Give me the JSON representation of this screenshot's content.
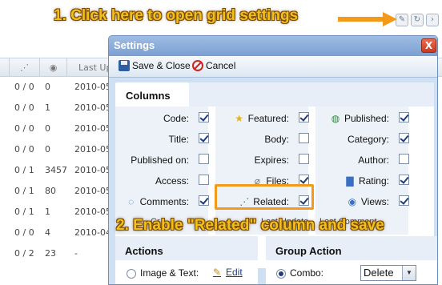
{
  "annotations": {
    "step1": "1. Click here to open grid settings",
    "step2": "2. Enable \"Related\" column and save"
  },
  "grid": {
    "header": {
      "col1_icon": "sort-icon",
      "col2_icon": "related-icon",
      "col3_icon": "views-icon",
      "col4": "Last Up"
    },
    "rows": [
      {
        "related": "0 / 0",
        "views": "0",
        "updated": "2010-05"
      },
      {
        "related": "0 / 0",
        "views": "1",
        "updated": "2010-05"
      },
      {
        "related": "0 / 0",
        "views": "0",
        "updated": "2010-05"
      },
      {
        "related": "0 / 0",
        "views": "0",
        "updated": "2010-05"
      },
      {
        "related": "0 / 1",
        "views": "3457",
        "updated": "2010-05"
      },
      {
        "related": "0 / 1",
        "views": "80",
        "updated": "2010-05"
      },
      {
        "related": "0 / 1",
        "views": "1",
        "updated": "2010-05"
      },
      {
        "related": "0 / 0",
        "views": "4",
        "updated": "2010-04"
      },
      {
        "related": "0 / 2",
        "views": "23",
        "updated": "-"
      }
    ],
    "icons": [
      "grid-settings-icon",
      "refresh-icon",
      "more-icon"
    ]
  },
  "dialog": {
    "title": "Settings",
    "close": "X",
    "toolbar": {
      "save": "Save & Close",
      "cancel": "Cancel"
    },
    "columns_title": "Columns",
    "fields": [
      {
        "label": "Code:",
        "checked": true,
        "icon": ""
      },
      {
        "label": "Featured:",
        "checked": true,
        "icon": "star-icon"
      },
      {
        "label": "Published:",
        "checked": true,
        "icon": "globe-icon"
      },
      {
        "label": "Title:",
        "checked": true,
        "icon": ""
      },
      {
        "label": "Body:",
        "checked": false,
        "icon": ""
      },
      {
        "label": "Category:",
        "checked": true,
        "icon": ""
      },
      {
        "label": "Published on:",
        "checked": false,
        "icon": ""
      },
      {
        "label": "Expires:",
        "checked": false,
        "icon": ""
      },
      {
        "label": "Author:",
        "checked": false,
        "icon": ""
      },
      {
        "label": "Access:",
        "checked": false,
        "icon": ""
      },
      {
        "label": "Files:",
        "checked": true,
        "icon": "paperclip-icon"
      },
      {
        "label": "Rating:",
        "checked": true,
        "icon": "bar-chart-icon"
      },
      {
        "label": "Comments:",
        "checked": true,
        "icon": "comment-icon"
      },
      {
        "label": "Related:",
        "checked": true,
        "icon": "related-icon"
      },
      {
        "label": "Views:",
        "checked": true,
        "icon": "eye-icon"
      }
    ],
    "partial_row": {
      "left": "Cr",
      "mid": "Last Update",
      "right": "Last Comment"
    },
    "actions": {
      "title": "Actions",
      "label": "Image & Text:",
      "edit": "Edit"
    },
    "group_action": {
      "title": "Group Action",
      "label": "Combo:",
      "value": "Delete"
    }
  },
  "colors": {
    "accent": "#f39a1a",
    "annotation_text": "#f3c019",
    "titlebar": "#7a9fd1",
    "close": "#c93a1f"
  }
}
